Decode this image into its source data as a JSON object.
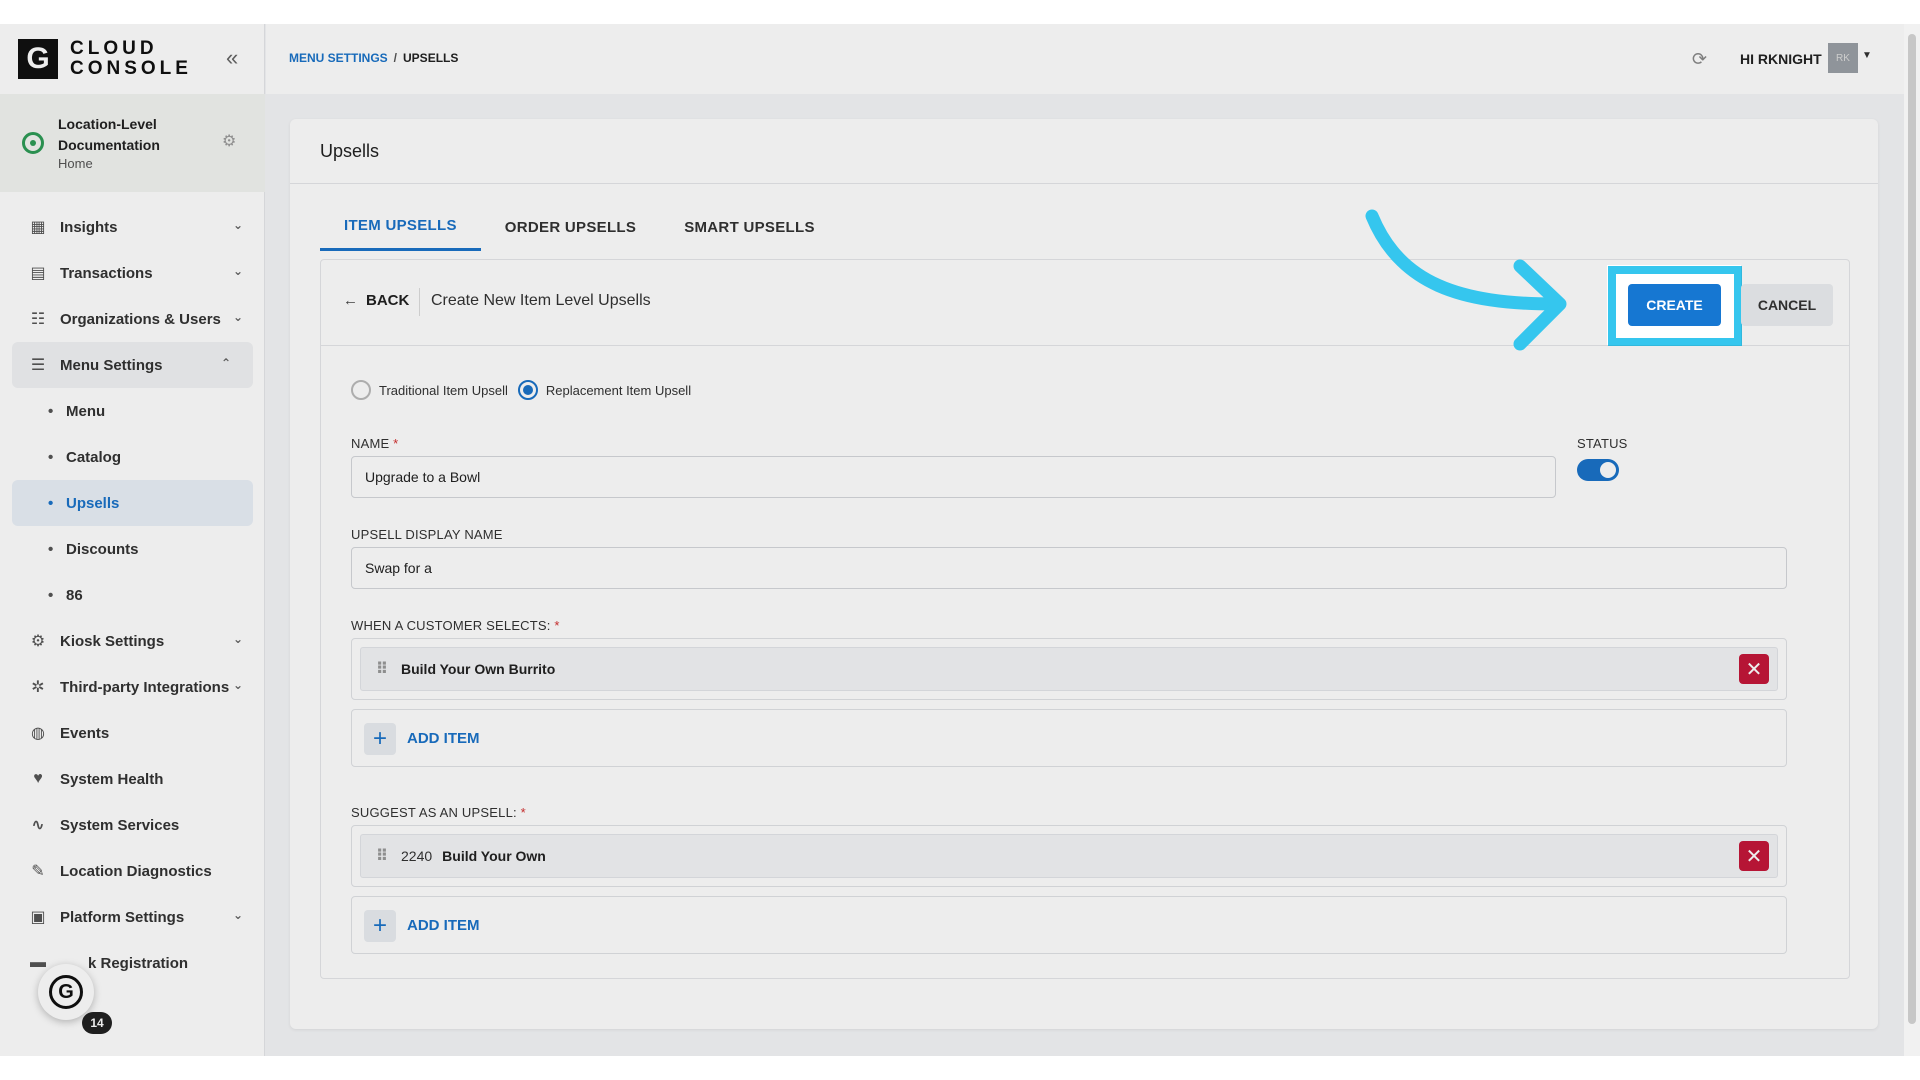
{
  "app": {
    "logo_letter": "G",
    "logo_line1": "CLOUD",
    "logo_line2": "CONSOLE"
  },
  "location": {
    "name": "Location-Level Documentation",
    "sub": "Home"
  },
  "sidebar": {
    "items": [
      {
        "label": "Insights",
        "icon": "insights-icon"
      },
      {
        "label": "Transactions",
        "icon": "transactions-icon"
      },
      {
        "label": "Organizations & Users",
        "icon": "org-icon"
      },
      {
        "label": "Menu Settings",
        "icon": "menu-settings-icon"
      }
    ],
    "sub_items": [
      "Menu",
      "Catalog",
      "Upsells",
      "Discounts",
      "86"
    ],
    "items_after": [
      {
        "label": "Kiosk Settings",
        "icon": "kiosk-icon"
      },
      {
        "label": "Third-party Integrations",
        "icon": "integrations-icon"
      },
      {
        "label": "Events",
        "icon": "events-icon"
      },
      {
        "label": "System Health",
        "icon": "health-icon"
      },
      {
        "label": "System Services",
        "icon": "services-icon"
      },
      {
        "label": "Location Diagnostics",
        "icon": "diagnostics-icon"
      },
      {
        "label": "Platform Settings",
        "icon": "platform-icon"
      },
      {
        "label": "k Registration",
        "icon": "registration-icon"
      }
    ],
    "badge_count": "14"
  },
  "topbar": {
    "breadcrumb_link": "MENU SETTINGS",
    "breadcrumb_sep": "/",
    "breadcrumb_current": "UPSELLS",
    "greeting": "HI RKNIGHT",
    "avatar_initials": "RK"
  },
  "page": {
    "title": "Upsells",
    "tabs": [
      "ITEM UPSELLS",
      "ORDER UPSELLS",
      "SMART UPSELLS"
    ],
    "back_label": "BACK",
    "form_title": "Create New Item Level Upsells",
    "create_label": "CREATE",
    "cancel_label": "CANCEL",
    "radio_traditional": "Traditional Item Upsell",
    "radio_replacement": "Replacement Item Upsell",
    "name_label": "NAME",
    "name_value": "Upgrade to a Bowl",
    "status_label": "STATUS",
    "display_name_label": "UPSELL DISPLAY NAME",
    "display_name_value": "Swap for a",
    "when_label": "WHEN A CUSTOMER SELECTS:",
    "when_item": "Build Your Own Burrito",
    "add_item_label": "ADD ITEM",
    "suggest_label": "SUGGEST AS AN UPSELL:",
    "suggest_item_num": "2240",
    "suggest_item": "Build Your Own",
    "required_mark": "*"
  },
  "colors": {
    "accent": "#1a73c9",
    "highlight": "#35c6ee",
    "danger": "#c4173a"
  }
}
